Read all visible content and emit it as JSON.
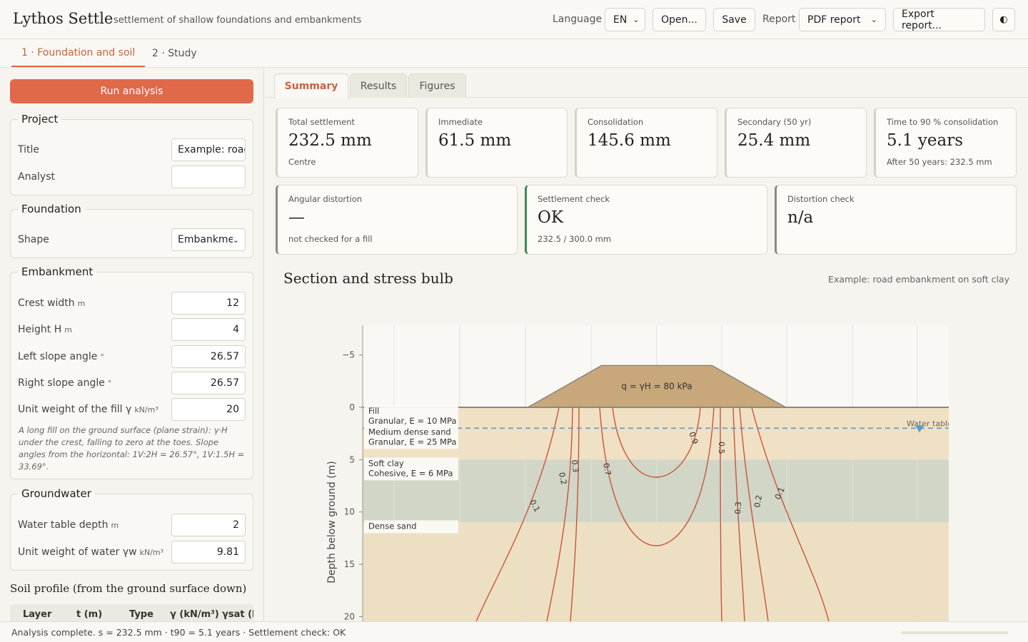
{
  "header": {
    "app_title": "Lythos Settle",
    "subtitle": "settlement of shallow foundations and embankments",
    "language_label": "Language",
    "language_value": "EN",
    "open_label": "Open...",
    "save_label": "Save",
    "report_label": "Report",
    "report_value": "PDF report",
    "export_label": "Export report...",
    "theme_icon": "contrast-icon"
  },
  "top_tabs": [
    {
      "label": "1 · Foundation and soil",
      "active": true
    },
    {
      "label": "2 · Study",
      "active": false
    }
  ],
  "sidebar": {
    "run_label": "Run analysis",
    "project": {
      "legend": "Project",
      "title_label": "Title",
      "title_value": "Example: road embankment on soft clay",
      "analyst_label": "Analyst",
      "analyst_value": ""
    },
    "foundation": {
      "legend": "Foundation",
      "shape_label": "Shape",
      "shape_value": "Embankment"
    },
    "embankment": {
      "legend": "Embankment",
      "fields": [
        {
          "label": "Crest width",
          "unit": "m",
          "value": "12"
        },
        {
          "label": "Height H",
          "unit": "m",
          "value": "4"
        },
        {
          "label": "Left slope angle",
          "unit": "°",
          "value": "26.57"
        },
        {
          "label": "Right slope angle",
          "unit": "°",
          "value": "26.57"
        },
        {
          "label": "Unit weight of the fill γ",
          "unit": "kN/m³",
          "value": "20"
        }
      ],
      "note": "A long fill on the ground surface (plane strain): γ·H under the crest, falling to zero at the toes. Slope angles from the horizontal: 1V:2H = 26.57°, 1V:1.5H = 33.69°."
    },
    "groundwater": {
      "legend": "Groundwater",
      "fields": [
        {
          "label": "Water table depth",
          "unit": "m",
          "value": "2"
        },
        {
          "label": "Unit weight of water γw",
          "unit": "kN/m³",
          "value": "9.81"
        }
      ]
    },
    "soil_profile": {
      "title": "Soil profile (from the ground surface down)",
      "columns": [
        "Layer",
        "t (m)",
        "Type",
        "γ (kN/m³)",
        "γsat (k"
      ]
    }
  },
  "main": {
    "tabs": [
      {
        "label": "Summary",
        "active": true
      },
      {
        "label": "Results",
        "active": false
      },
      {
        "label": "Figures",
        "active": false
      }
    ],
    "cards_row1": [
      {
        "label": "Total settlement",
        "value": "232.5 mm",
        "sub": "Centre"
      },
      {
        "label": "Immediate",
        "value": "61.5 mm",
        "sub": ""
      },
      {
        "label": "Consolidation",
        "value": "145.6 mm",
        "sub": ""
      },
      {
        "label": "Secondary (50 yr)",
        "value": "25.4 mm",
        "sub": ""
      },
      {
        "label": "Time to 90 % consolidation",
        "value": "5.1 years",
        "sub": "After 50 years: 232.5 mm"
      }
    ],
    "cards_row2": [
      {
        "label": "Angular distortion",
        "value": "—",
        "sub": "not checked for a fill",
        "status": "grey"
      },
      {
        "label": "Settlement check",
        "value": "OK",
        "sub": "232.5 / 300.0 mm",
        "status": "ok"
      },
      {
        "label": "Distortion check",
        "value": "n/a",
        "sub": "",
        "status": "grey"
      }
    ],
    "section_title": "Section and stress bulb",
    "section_subtitle": "Example: road embankment on soft clay"
  },
  "chart_data": {
    "type": "contour",
    "ylabel": "Depth below ground (m)",
    "y_ticks": [
      -5,
      0,
      5,
      10,
      15,
      20
    ],
    "ylim": [
      -7.5,
      20.5
    ],
    "load_label": "q = γH = 80 kPa",
    "water_table_label": "Water table",
    "water_table_depth": 2,
    "embankment": {
      "crest_width": 12,
      "height": 4,
      "slope_angle_deg": 26.57
    },
    "layers": [
      {
        "name": "Fill",
        "desc": "Granular, E = 10 MPa",
        "top": 0,
        "bottom": 2,
        "color": "#f0e1c4"
      },
      {
        "name": "Medium dense sand",
        "desc": "Granular, E = 25 MPa",
        "top": 2,
        "bottom": 5,
        "color": "#f0e1c4"
      },
      {
        "name": "Soft clay",
        "desc": "Cohesive, E = 6 MPa",
        "top": 5,
        "bottom": 11,
        "color": "#d1d6c6"
      },
      {
        "name": "Dense sand",
        "desc": "",
        "top": 11,
        "bottom": 21,
        "color": "#ede0c2"
      }
    ],
    "contour_levels": [
      "0.1",
      "0.2",
      "0.3",
      "0.5",
      "0.7",
      "0.9"
    ],
    "colors": {
      "contour": "#c9543a",
      "water": "#5a9bc2",
      "embankment": "#c8a77a"
    }
  },
  "status": {
    "text": "Analysis complete. s = 232.5 mm · t90 = 5.1 years · Settlement check: OK",
    "progress": 1.0
  }
}
